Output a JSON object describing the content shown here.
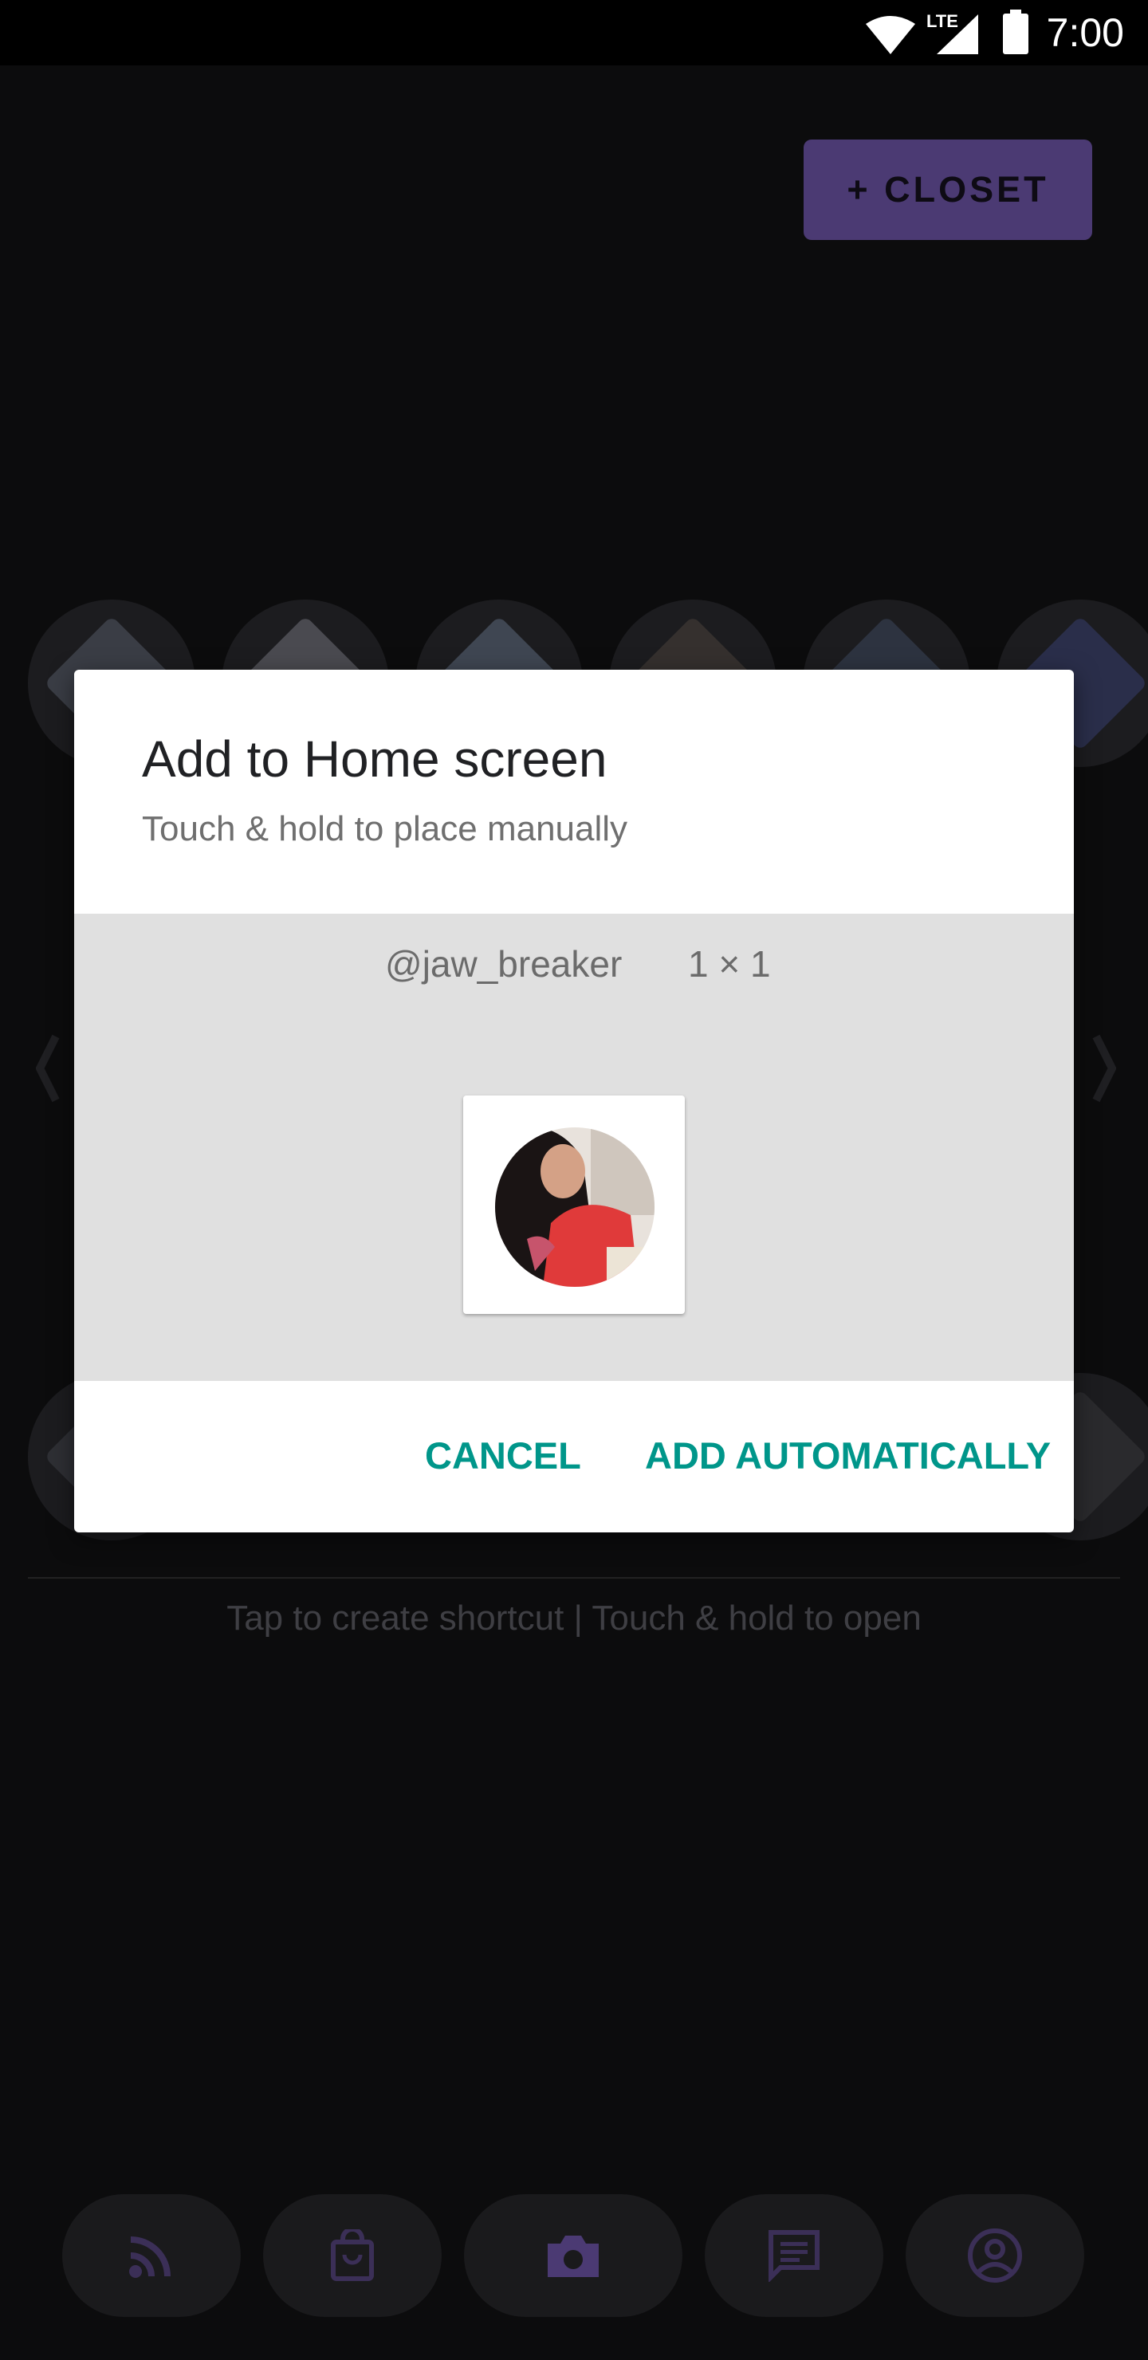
{
  "status_bar": {
    "time": "7:00",
    "network_label": "LTE",
    "icons": [
      "wifi-icon",
      "lte-signal-icon",
      "battery-icon"
    ]
  },
  "background_app": {
    "closet_button_label": "+ CLOSET",
    "hint_text": "Tap to create shortcut | Touch & hold to open",
    "bottom_nav": [
      "rss-icon",
      "shopping-bag-icon",
      "camera-icon",
      "message-icon",
      "account-icon"
    ],
    "accent_color": "#4b3a73"
  },
  "dialog": {
    "title": "Add to Home screen",
    "subtitle": "Touch & hold to place manually",
    "widget_name": "@jaw_breaker",
    "widget_size": "1 × 1",
    "cancel_label": "CANCEL",
    "add_label": "ADD AUTOMATICALLY",
    "button_color": "#00968a"
  }
}
